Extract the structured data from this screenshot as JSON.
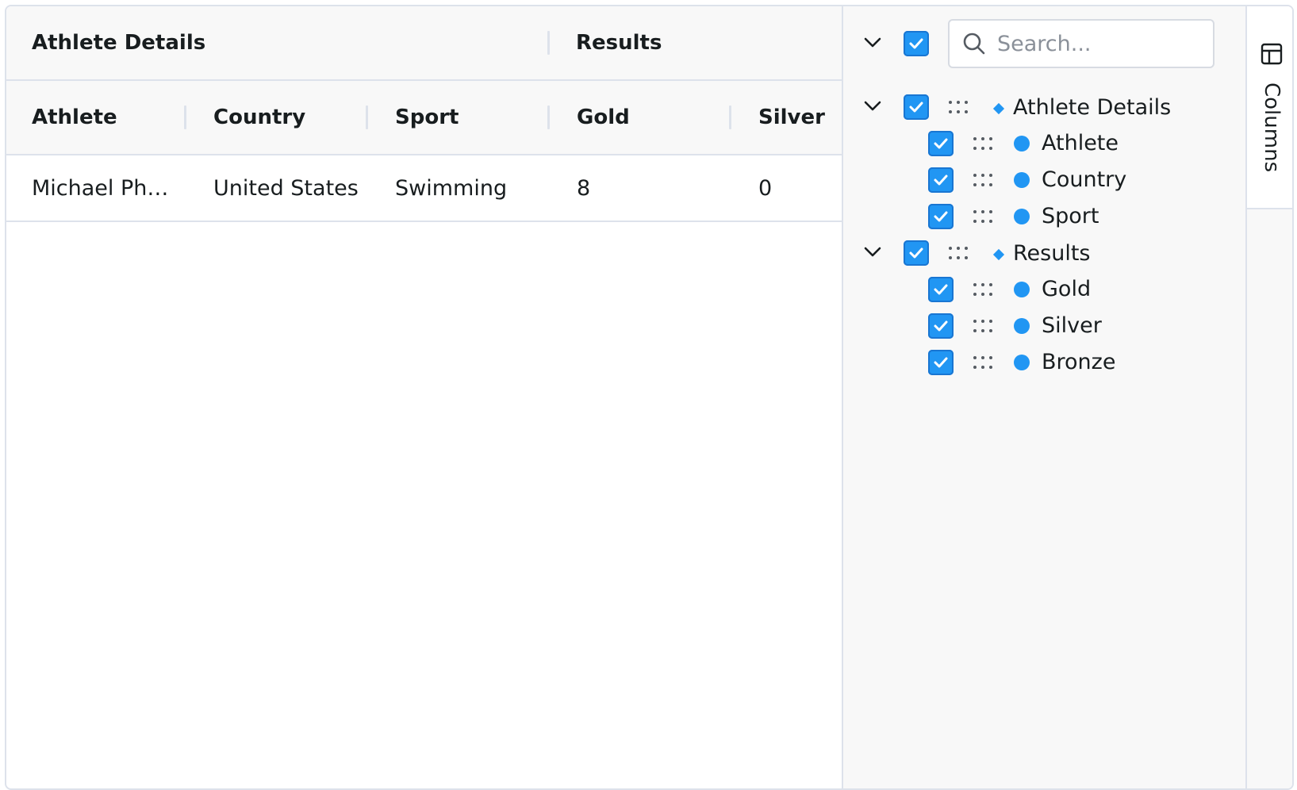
{
  "grid": {
    "group_headers": [
      "Athlete Details",
      "Results"
    ],
    "column_headers": [
      "Athlete",
      "Country",
      "Sport",
      "Gold",
      "Silver"
    ],
    "rows": [
      {
        "athlete": "Michael Phelps",
        "country": "United States",
        "sport": "Swimming",
        "gold": "8",
        "silver": "0"
      }
    ]
  },
  "tool_panel": {
    "search_placeholder": "Search...",
    "select_all_checked": true,
    "groups": [
      {
        "label": "Athlete Details",
        "expanded": true,
        "checked": true,
        "columns": [
          {
            "label": "Athlete",
            "checked": true
          },
          {
            "label": "Country",
            "checked": true
          },
          {
            "label": "Sport",
            "checked": true
          }
        ]
      },
      {
        "label": "Results",
        "expanded": true,
        "checked": true,
        "columns": [
          {
            "label": "Gold",
            "checked": true
          },
          {
            "label": "Silver",
            "checked": true
          },
          {
            "label": "Bronze",
            "checked": true
          }
        ]
      }
    ]
  },
  "side_bar": {
    "buttons": [
      {
        "label": "Columns",
        "icon": "columns-icon"
      }
    ]
  },
  "colors": {
    "accent": "#2196f3",
    "header_bg": "#f8f8f8",
    "border": "#dde2eb",
    "text": "#181d1f"
  }
}
